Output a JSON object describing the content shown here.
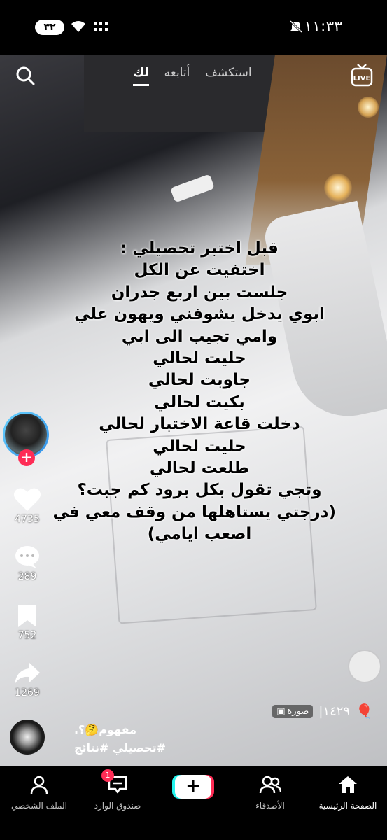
{
  "status_bar": {
    "time": "١١:٣٣",
    "battery": "٣٢"
  },
  "top_nav": {
    "tabs": [
      {
        "label": "استكشف"
      },
      {
        "label": "أتابعه"
      },
      {
        "label": "لك",
        "active": true
      }
    ],
    "live_label": "LIVE"
  },
  "caption_lines": [
    "قبل اختبر تحصيلي :",
    "اختفيت عن الكل",
    "جلست بين اربع جدران",
    "ابوي يدخل يشوفني ويهون علي",
    "وامي تجيب الى ابي",
    "حليت لحالي",
    "جاوبت لحالي",
    "بكيت لحالي",
    "دخلت قاعة الاختبار لحالي",
    "حليت لحالي",
    "طلعت لحالي",
    "وتجي تقول بكل برود كم جبت؟",
    "(درجتي يستاهلها من وقف معي في",
    "اصعب ايامي)"
  ],
  "actions": {
    "likes": "4735",
    "comments": "289",
    "saves": "752",
    "shares": "1269"
  },
  "post": {
    "views": "١٤٢٩|",
    "photo_label": "صورة",
    "description_line1": "مفهوم🤔؟.",
    "description_line2": "#تحصيلي #نتائج"
  },
  "bottom_nav": {
    "home": "الصفحة الرئيسية",
    "friends": "الأصدقاء",
    "add": "+",
    "inbox": "صندوق الوارد",
    "inbox_badge": "1",
    "profile": "الملف الشخصي"
  }
}
